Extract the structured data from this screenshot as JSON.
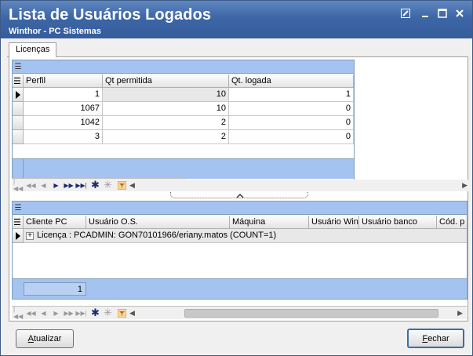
{
  "window": {
    "title": "Lista de Usuários Logados",
    "subtitle": "Winthor - PC Sistemas"
  },
  "tabs": [
    {
      "label": "Licenças"
    }
  ],
  "top_grid": {
    "columns": [
      "Perfil",
      "Qt permitida",
      "Qt. logada"
    ],
    "rows": [
      [
        "1",
        "10",
        "1"
      ],
      [
        "1067",
        "10",
        "0"
      ],
      [
        "1042",
        "2",
        "0"
      ],
      [
        "3",
        "2",
        "0"
      ]
    ]
  },
  "bottom_grid": {
    "columns": [
      "Cliente PC",
      "Usuário O.S.",
      "Máquina",
      "Usuário Win",
      "Usuário banco",
      "Cód. p"
    ],
    "group_row": "Licença : PCADMIN: GON70101966/eriany.matos (COUNT=1)",
    "footer_count": "1"
  },
  "buttons": {
    "refresh_prefix": "A",
    "refresh_rest": "tualizar",
    "close_prefix": "F",
    "close_rest": "echar"
  },
  "colors": {
    "titlebar": "#3d66a6",
    "band": "#a5c3f0"
  }
}
